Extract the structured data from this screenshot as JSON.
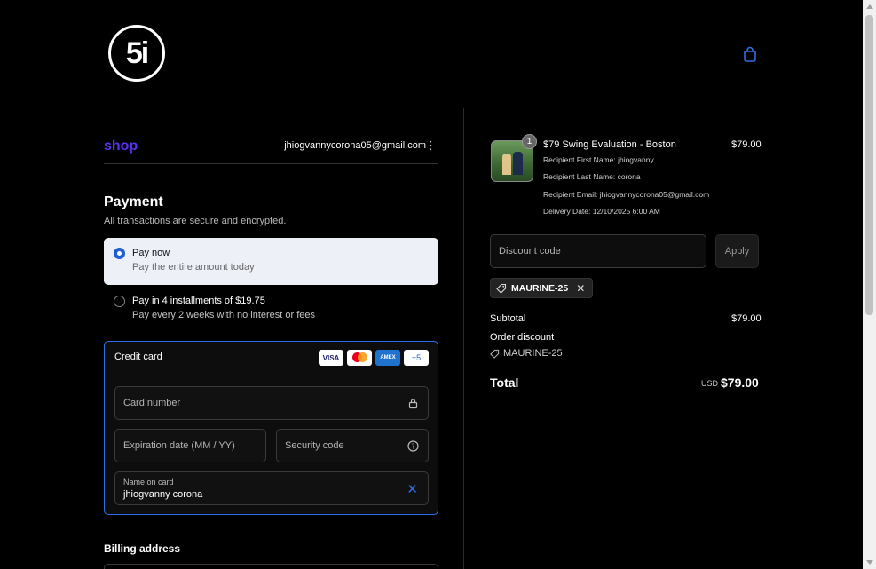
{
  "header": {
    "logo_text": "5i",
    "cart_icon": "shopping-bag-icon"
  },
  "account": {
    "shop_label": "shop",
    "email": "jhiogvannycorona05@gmail.com"
  },
  "payment": {
    "title": "Payment",
    "subtitle": "All transactions are secure and encrypted.",
    "options": [
      {
        "title": "Pay now",
        "subtitle": "Pay the entire amount today",
        "selected": true
      },
      {
        "title": "Pay in 4 installments of $19.75",
        "subtitle": "Pay every 2 weeks with no interest or fees",
        "selected": false
      }
    ],
    "credit_card": {
      "label": "Credit card",
      "card_brands": [
        "VISA",
        "Mastercard",
        "AMEX",
        "+5"
      ],
      "card_number_placeholder": "Card number",
      "expiration_placeholder": "Expiration date (MM / YY)",
      "security_placeholder": "Security code",
      "name_label": "Name on card",
      "name_value": "jhiogvanny corona"
    },
    "billing_title": "Billing address"
  },
  "order": {
    "item": {
      "quantity": "1",
      "title": "$79 Swing Evaluation - Boston",
      "price": "$79.00",
      "meta": [
        "Recipient First Name: jhiogvanny",
        "Recipient Last Name: corona",
        "Recipient Email: jhiogvannycorona05@gmail.com",
        "Delivery Date: 12/10/2025 6:00 AM"
      ]
    },
    "discount_placeholder": "Discount code",
    "apply_label": "Apply",
    "applied_code": "MAURINE-25",
    "subtotal_label": "Subtotal",
    "subtotal_value": "$79.00",
    "order_discount_label": "Order discount",
    "order_discount_code": "MAURINE-25",
    "total_label": "Total",
    "total_currency": "USD",
    "total_value": "$79.00"
  },
  "colors": {
    "accent": "#2f6fe0",
    "shop_brand": "#5a31f4",
    "background": "#000000"
  }
}
